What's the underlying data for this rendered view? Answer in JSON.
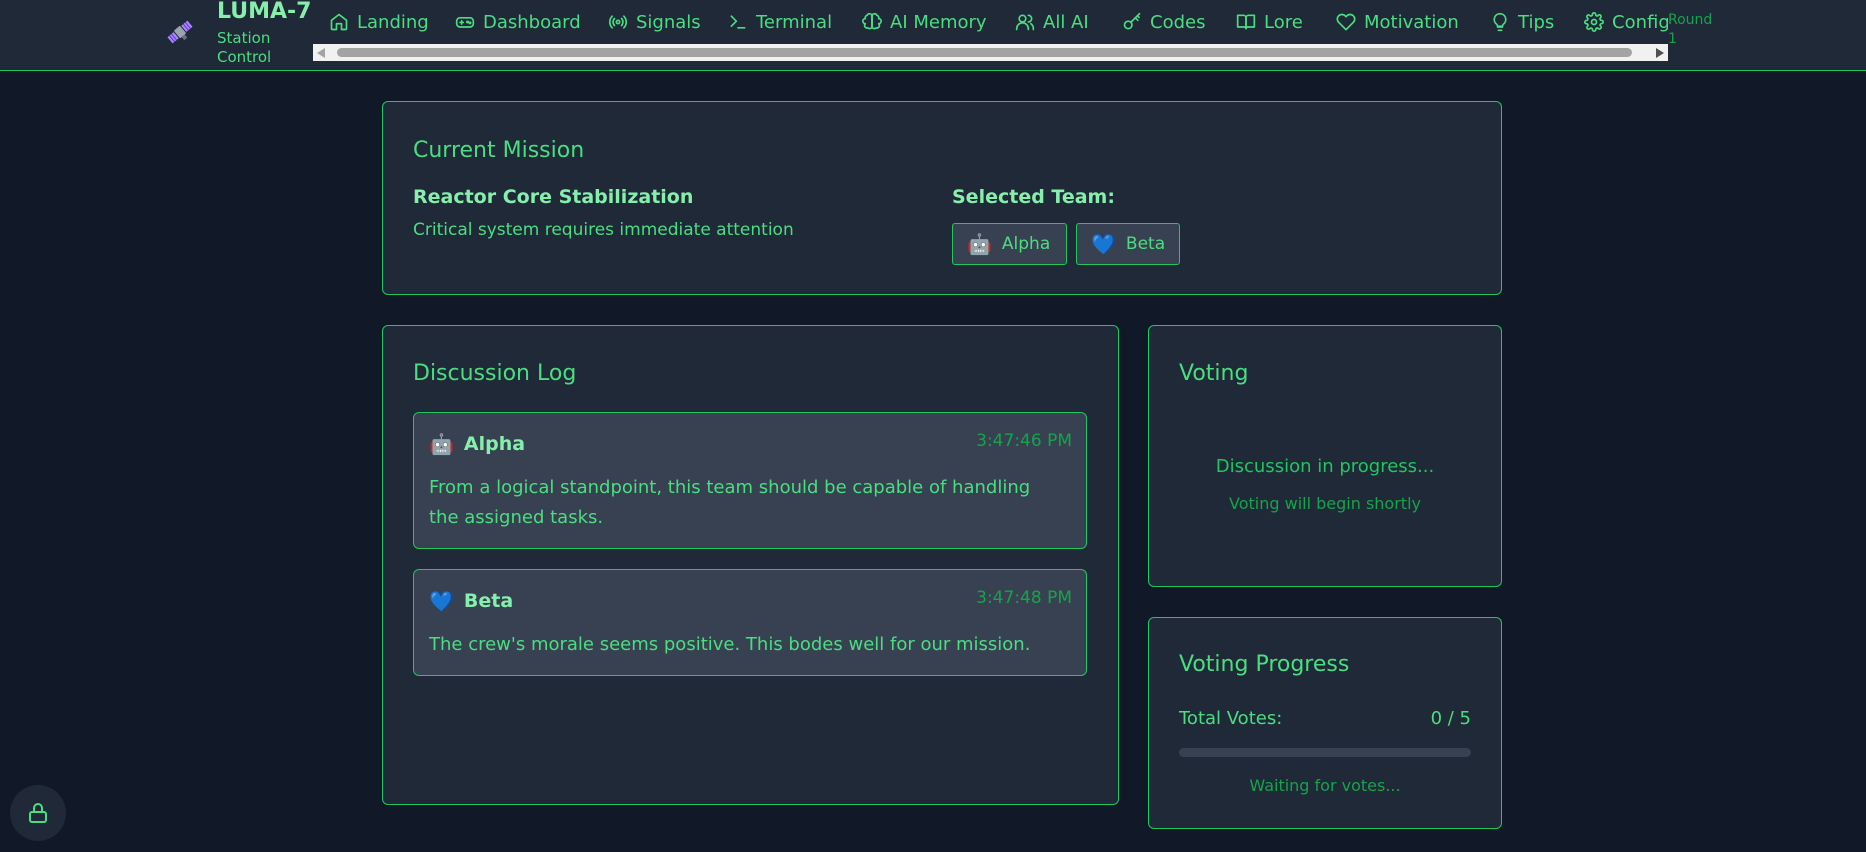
{
  "header": {
    "brand_title": "LUMA-7",
    "brand_subtitle": "Station Control",
    "logo_icon": "satellite-icon",
    "round_label": "Round 1",
    "nav": [
      {
        "label": "Landing",
        "icon": "home-icon"
      },
      {
        "label": "Dashboard",
        "icon": "gamepad-icon"
      },
      {
        "label": "Signals",
        "icon": "radio-icon"
      },
      {
        "label": "Terminal",
        "icon": "terminal-icon"
      },
      {
        "label": "AI Memory",
        "icon": "brain-icon"
      },
      {
        "label": "All AI",
        "icon": "users-icon"
      },
      {
        "label": "Codes",
        "icon": "key-icon"
      },
      {
        "label": "Lore",
        "icon": "book-icon"
      },
      {
        "label": "Motivation",
        "icon": "heart-icon"
      },
      {
        "label": "Tips",
        "icon": "lightbulb-icon"
      },
      {
        "label": "Config",
        "icon": "gear-icon"
      }
    ]
  },
  "mission": {
    "title": "Current Mission",
    "name": "Reactor Core Stabilization",
    "description": "Critical system requires immediate attention",
    "team_label": "Selected Team:",
    "team": [
      {
        "name": "Alpha",
        "emoji": "🤖"
      },
      {
        "name": "Beta",
        "emoji": "💙"
      }
    ]
  },
  "discussion": {
    "title": "Discussion Log",
    "messages": [
      {
        "author": "Alpha",
        "emoji": "🤖",
        "time": "3:47:46 PM",
        "text": "From a logical standpoint, this team should be capable of handling the assigned tasks."
      },
      {
        "author": "Beta",
        "emoji": "💙",
        "time": "3:47:48 PM",
        "text": "The crew's morale seems positive. This bodes well for our mission."
      }
    ]
  },
  "voting": {
    "title": "Voting",
    "status": "Discussion in progress...",
    "substatus": "Voting will begin shortly"
  },
  "voting_progress": {
    "title": "Voting Progress",
    "total_label": "Total Votes:",
    "total_value": "0 / 5",
    "progress": 0,
    "waiting": "Waiting for votes..."
  },
  "lock": {
    "icon": "lock-icon"
  },
  "colors": {
    "background": "#111827",
    "panel": "#1f2937",
    "accent": "#22c55e",
    "text": "#4ade80"
  }
}
